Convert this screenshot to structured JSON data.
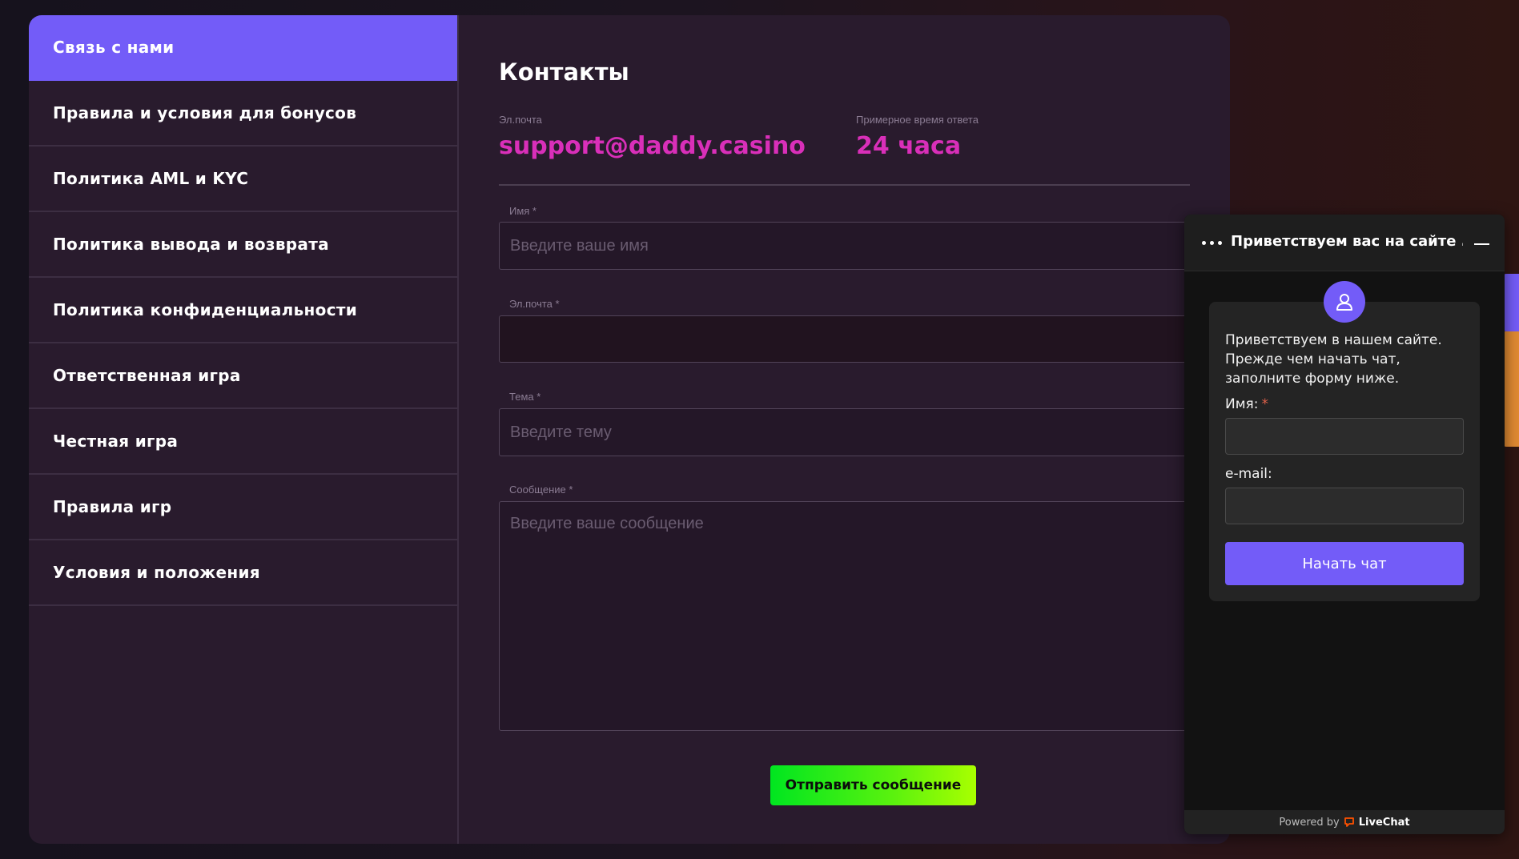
{
  "sidebar": {
    "items": [
      {
        "label": "Связь с нами",
        "active": true
      },
      {
        "label": "Правила и условия для бонусов"
      },
      {
        "label": "Политика AML и KYC"
      },
      {
        "label": "Политика вывода и возврата"
      },
      {
        "label": "Политика конфиденциальности"
      },
      {
        "label": "Ответственная игра"
      },
      {
        "label": "Честная игра"
      },
      {
        "label": "Правила игр"
      },
      {
        "label": "Условия и положения"
      }
    ]
  },
  "contacts": {
    "title": "Контакты",
    "email_label": "Эл.почта",
    "email_value": "support@daddy.casino",
    "response_label": "Примерное время ответа",
    "response_value": "24 часа"
  },
  "form": {
    "name": {
      "label": "Имя *",
      "placeholder": "Введите ваше имя",
      "value": ""
    },
    "email": {
      "label": "Эл.почта *",
      "placeholder": "",
      "value": ""
    },
    "subject": {
      "label": "Тема *",
      "placeholder": "Введите тему",
      "value": ""
    },
    "message": {
      "label": "Сообщение *",
      "placeholder": "Введите ваше сообщение",
      "value": ""
    },
    "submit_label": "Отправить сообщение"
  },
  "chat": {
    "header_title": "Приветствуем вас на сайте ...",
    "intro": "Приветствуем в нашем сайте. Прежде чем начать чат, заполните форму ниже.",
    "name_label": "Имя:",
    "name_required_mark": "*",
    "email_label": "e-mail:",
    "start_label": "Начать чат",
    "powered_prefix": "Powered by",
    "powered_brand": "LiveChat"
  },
  "icons": {
    "menu": "dots-icon",
    "minimize": "minimize-icon",
    "avatar": "user-icon",
    "brand": "livechat-logo-icon"
  },
  "colors": {
    "accent": "#735cf8",
    "highlight": "#d92fb9",
    "submit_start": "#00e620",
    "submit_end": "#a9ff00",
    "card_bg": "#291b2d"
  }
}
